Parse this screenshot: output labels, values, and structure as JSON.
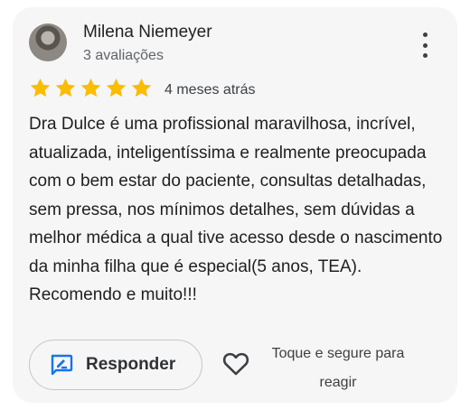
{
  "review": {
    "author": "Milena Niemeyer",
    "author_reviews": "3 avaliações",
    "rating": 5,
    "time_ago": "4 meses atrás",
    "text": "Dra Dulce é uma profissional maravilhosa, incrível, atualizada, inteligentíssima e realmente preocupada com o bem estar do paciente, consultas detalhadas, sem pressa, nos mínimos detalhes, sem dúvidas a melhor médica a qual tive acesso desde o nascimento da minha filha que é especial(5 anos, TEA). Recomendo e muito!!!"
  },
  "actions": {
    "reply_label": "Responder",
    "react_hint": "Toque e segure para reagir"
  },
  "icons": {
    "star": "star-icon",
    "more": "more-vert-icon",
    "reply": "rate-review-icon",
    "heart": "heart-outline-icon"
  },
  "colors": {
    "star": "#fbbc04",
    "reply_icon": "#1a73e8",
    "card_background": "#f6f6f7"
  }
}
